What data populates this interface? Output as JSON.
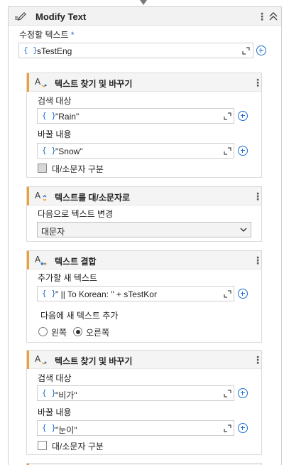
{
  "activity": {
    "title": "Modify Text",
    "icon": "edit-text-icon",
    "target_label": "수정할 텍스트",
    "required_mark": "*",
    "target_value": "sTestEng"
  },
  "brace": "{ }",
  "cards": [
    {
      "title": "텍스트 찾기 및 바꾸기",
      "search_label": "검색 대상",
      "search_value": "\"Rain\"",
      "replace_label": "바꿀 내용",
      "replace_value": "\"Snow\"",
      "case_label": "대/소문자 구분",
      "case_checked": false
    },
    {
      "title": "텍스트를 대/소문자로",
      "change_label": "다음으로 텍스트 변경",
      "change_value": "대문자"
    },
    {
      "title": "텍스트 결합",
      "add_label": "추가할 새 텍스트",
      "add_value": "\" || To Korean: \" + sTestKor",
      "position_label": "다음에 새 텍스트 추가",
      "option_left": "왼쪽",
      "option_right": "오른쪽",
      "selected": "오른쪽"
    },
    {
      "title": "텍스트 찾기 및 바꾸기",
      "search_label": "검색 대상",
      "search_value": "\"비가\"",
      "replace_label": "바꿀 내용",
      "replace_value": "\"눈이\"",
      "case_label": "대/소문자 구분",
      "case_checked": false
    }
  ],
  "colors": {
    "accent": "#f0a030",
    "link_blue": "#1f6fd0",
    "header_bg": "#f2f2f2"
  }
}
